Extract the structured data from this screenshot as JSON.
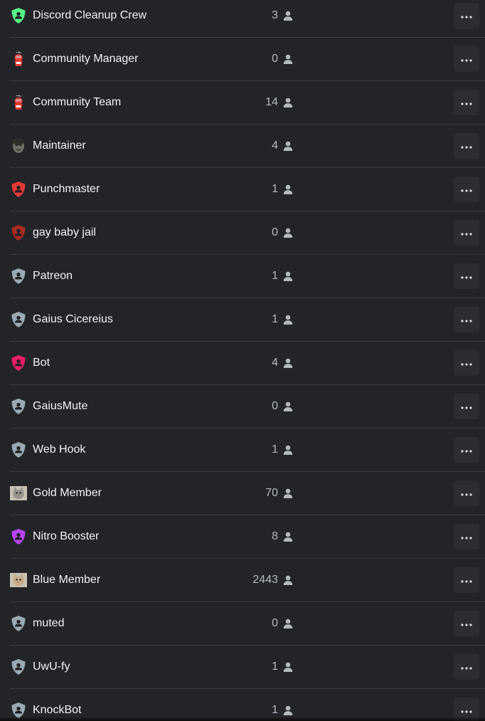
{
  "roles": [
    {
      "name": "Discord Cleanup Crew",
      "count": "3",
      "icon": "shield-icon",
      "color": "#57f287"
    },
    {
      "name": "Community Manager",
      "count": "0",
      "icon": "mascot-icon",
      "color": "#e53935"
    },
    {
      "name": "Community Team",
      "count": "14",
      "icon": "mascot-icon",
      "color": "#e53935"
    },
    {
      "name": "Maintainer",
      "count": "4",
      "icon": "face-photo-icon",
      "color": "#6b6f66"
    },
    {
      "name": "Punchmaster",
      "count": "1",
      "icon": "shield-icon",
      "color": "#e53935"
    },
    {
      "name": "gay baby jail",
      "count": "0",
      "icon": "shield-icon",
      "color": "#a52a22"
    },
    {
      "name": "Patreon",
      "count": "1",
      "icon": "shield-icon",
      "color": "#99aab5"
    },
    {
      "name": "Gaius Cicereius",
      "count": "1",
      "icon": "shield-icon",
      "color": "#99aab5"
    },
    {
      "name": "Bot",
      "count": "4",
      "icon": "shield-icon",
      "color": "#e91e63"
    },
    {
      "name": "GaiusMute",
      "count": "0",
      "icon": "shield-icon",
      "color": "#99aab5"
    },
    {
      "name": "Web Hook",
      "count": "1",
      "icon": "shield-icon",
      "color": "#99aab5"
    },
    {
      "name": "Gold Member",
      "count": "70",
      "icon": "cat-photo-icon",
      "color": "#9a9590"
    },
    {
      "name": "Nitro Booster",
      "count": "8",
      "icon": "shield-icon",
      "color": "#b845f5"
    },
    {
      "name": "Blue Member",
      "count": "2443",
      "icon": "cat-photo-icon",
      "color": "#c9ab88"
    },
    {
      "name": "muted",
      "count": "0",
      "icon": "shield-icon",
      "color": "#99aab5"
    },
    {
      "name": "UwU-fy",
      "count": "1",
      "icon": "shield-icon",
      "color": "#99aab5"
    },
    {
      "name": "KnockBot",
      "count": "1",
      "icon": "shield-icon",
      "color": "#99aab5"
    }
  ],
  "row_icons": {
    "member": "person-icon",
    "more": "ellipsis-icon"
  }
}
